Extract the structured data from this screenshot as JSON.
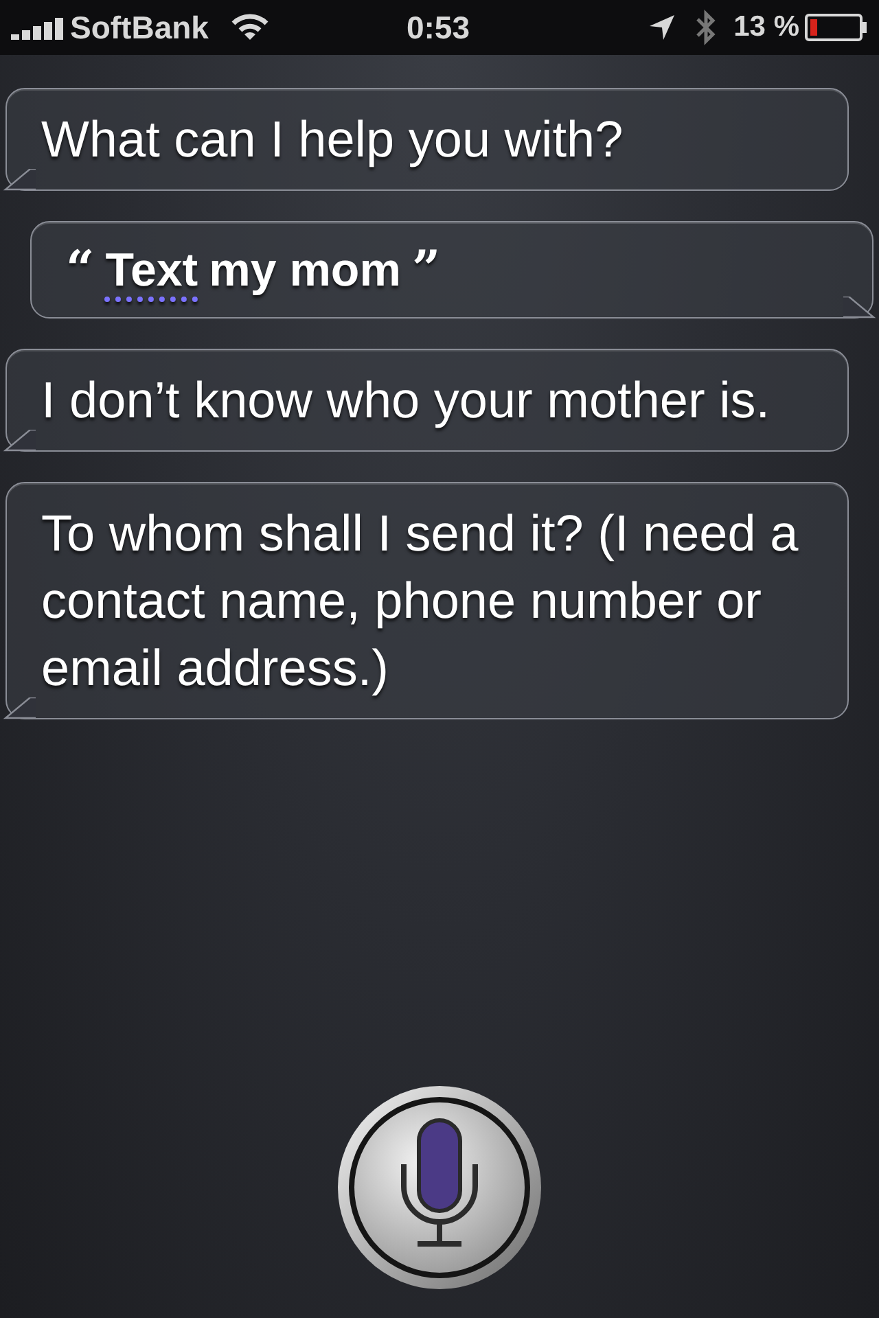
{
  "status_bar": {
    "carrier": "SoftBank",
    "time": "0:53",
    "battery": "13 %"
  },
  "bubbles": [
    {
      "kind": "assistant",
      "text": "What can I help you with?"
    },
    {
      "kind": "user",
      "quote_open": "“",
      "words": [
        {
          "text": "Text",
          "underlined": true
        },
        {
          "text": "my mom",
          "underlined": false
        }
      ],
      "quote_close": "”"
    },
    {
      "kind": "assistant",
      "text": "I don’t know who your mother is."
    },
    {
      "kind": "assistant",
      "text": "To whom shall I send it? (I need a contact name, phone number or email address.)"
    }
  ]
}
